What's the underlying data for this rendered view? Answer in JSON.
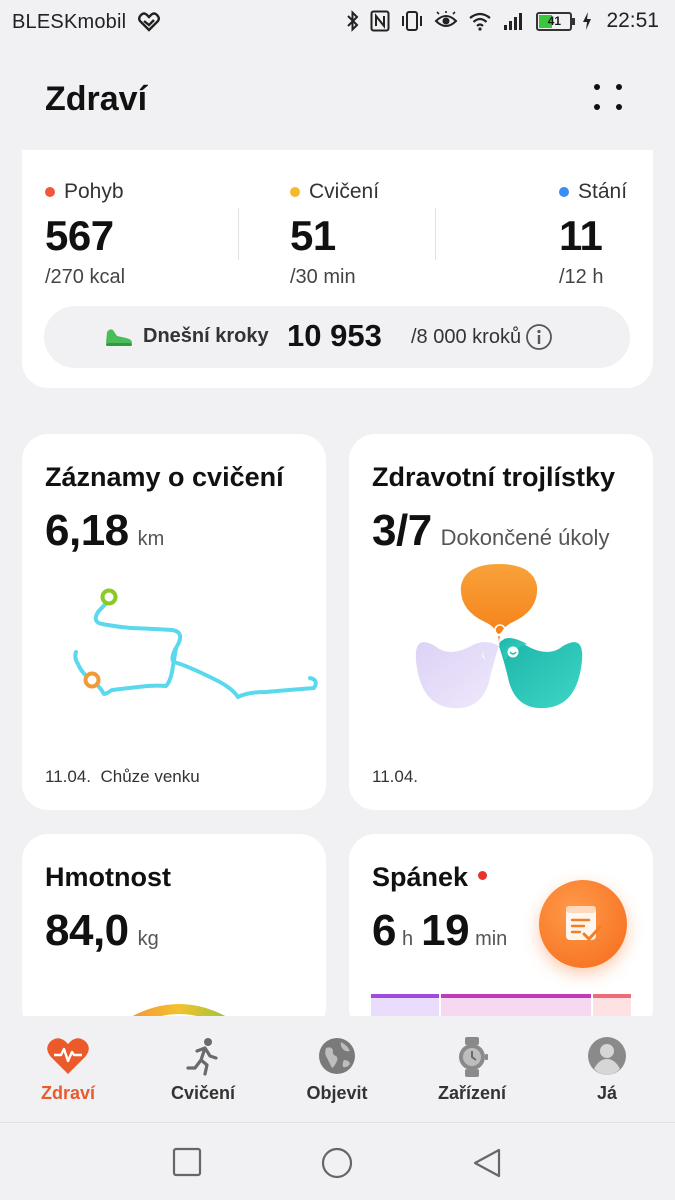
{
  "status_bar": {
    "carrier": "BLESKmobil",
    "battery_level": "41",
    "time": "22:51"
  },
  "header": {
    "title": "Zdraví"
  },
  "activity": {
    "rings": [
      {
        "label": "Pohyb",
        "value": "567",
        "goal": "/270 kcal",
        "color": "#f0573b"
      },
      {
        "label": "Cvičení",
        "value": "51",
        "goal": "/30 min",
        "color": "#f5b82e"
      },
      {
        "label": "Stání",
        "value": "11",
        "goal": "/12 h",
        "color": "#3b8cf5"
      }
    ],
    "steps": {
      "label": "Dnešní kroky",
      "value": "10 953",
      "goal": "/8 000 kroků"
    }
  },
  "cards": {
    "exercise": {
      "title": "Záznamy o cvičení",
      "value": "6,18",
      "unit": "km",
      "date": "11.04.",
      "activity": "Chůze venku"
    },
    "trefoil": {
      "title": "Zdravotní trojlístky",
      "value": "3/7",
      "caption": "Dokončené úkoly",
      "date": "11.04."
    },
    "weight": {
      "title": "Hmotnost",
      "value": "84,0",
      "unit": "kg"
    },
    "sleep": {
      "title": "Spánek",
      "hours": "6",
      "hours_unit": "h",
      "minutes": "19",
      "minutes_unit": "min"
    }
  },
  "bottom_nav": {
    "items": [
      {
        "label": "Zdraví",
        "active": true
      },
      {
        "label": "Cvičení"
      },
      {
        "label": "Objevit"
      },
      {
        "label": "Zařízení"
      },
      {
        "label": "Já"
      }
    ]
  },
  "colors": {
    "accent": "#ea5a2b",
    "route": "#5ad8ec"
  }
}
